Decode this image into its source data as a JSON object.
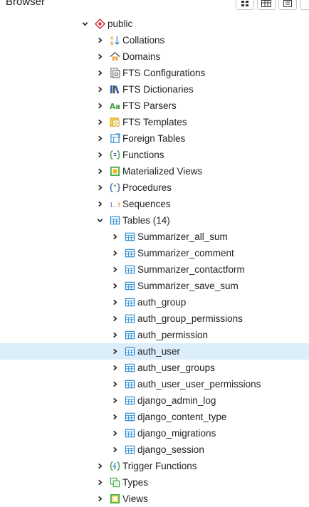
{
  "panel": {
    "title": "Browser"
  },
  "toolbar": {
    "buttons": [
      "object-explorer-icon",
      "table-view-icon",
      "sql-icon"
    ]
  },
  "schema": {
    "label": "public",
    "icon": "schema-icon",
    "expanded": true
  },
  "groups_before": [
    {
      "label": "Collations",
      "icon": "collation-icon"
    },
    {
      "label": "Domains",
      "icon": "domain-icon"
    },
    {
      "label": "FTS Configurations",
      "icon": "fts-configuration-icon"
    },
    {
      "label": "FTS Dictionaries",
      "icon": "fts-dictionary-icon"
    },
    {
      "label": "FTS Parsers",
      "icon": "fts-parser-icon"
    },
    {
      "label": "FTS Templates",
      "icon": "fts-template-icon"
    },
    {
      "label": "Foreign Tables",
      "icon": "foreign-table-icon"
    },
    {
      "label": "Functions",
      "icon": "function-icon"
    },
    {
      "label": "Materialized Views",
      "icon": "materialized-view-icon"
    },
    {
      "label": "Procedures",
      "icon": "procedure-icon"
    },
    {
      "label": "Sequences",
      "icon": "sequence-icon"
    }
  ],
  "tables_group": {
    "label": "Tables (14)",
    "icon": "table-group-icon",
    "expanded": true
  },
  "tables": [
    {
      "label": "Summarizer_all_sum"
    },
    {
      "label": "Summarizer_comment"
    },
    {
      "label": "Summarizer_contactform"
    },
    {
      "label": "Summarizer_save_sum"
    },
    {
      "label": "auth_group"
    },
    {
      "label": "auth_group_permissions"
    },
    {
      "label": "auth_permission"
    },
    {
      "label": "auth_user",
      "selected": true
    },
    {
      "label": "auth_user_groups"
    },
    {
      "label": "auth_user_user_permissions"
    },
    {
      "label": "django_admin_log"
    },
    {
      "label": "django_content_type"
    },
    {
      "label": "django_migrations"
    },
    {
      "label": "django_session"
    }
  ],
  "groups_after": [
    {
      "label": "Trigger Functions",
      "icon": "trigger-function-icon"
    },
    {
      "label": "Types",
      "icon": "type-icon"
    },
    {
      "label": "Views",
      "icon": "view-icon"
    }
  ],
  "colors": {
    "selected_row": "#dbeefa",
    "table_icon": "#2f8fd6",
    "schema_icon": "#d9363e",
    "accent_green": "#4caf50",
    "accent_yellow": "#f0b400"
  }
}
